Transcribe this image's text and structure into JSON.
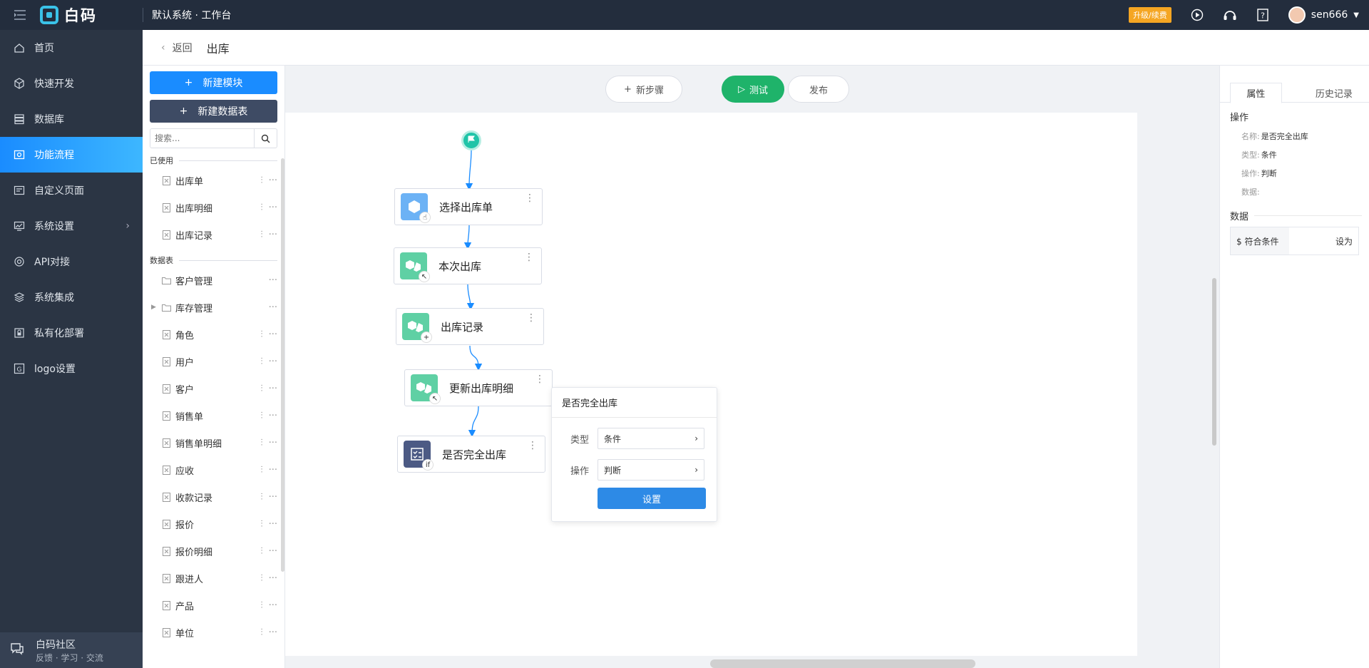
{
  "topbar": {
    "logo_text": "白码",
    "system_title": "默认系统 · 工作台",
    "upgrade_label": "升级/续费",
    "username": "sen666"
  },
  "sidebar": {
    "items": [
      {
        "label": "首页",
        "icon": "home-icon"
      },
      {
        "label": "快速开发",
        "icon": "cube-icon"
      },
      {
        "label": "数据库",
        "icon": "database-icon"
      },
      {
        "label": "功能流程",
        "icon": "flow-icon"
      },
      {
        "label": "自定义页面",
        "icon": "page-icon"
      },
      {
        "label": "系统设置",
        "icon": "settings-icon"
      },
      {
        "label": "API对接",
        "icon": "api-icon"
      },
      {
        "label": "系统集成",
        "icon": "layers-icon"
      },
      {
        "label": "私有化部署",
        "icon": "lock-icon"
      },
      {
        "label": "logo设置",
        "icon": "logo-icon"
      }
    ],
    "community": {
      "title": "白码社区",
      "subtitle": "反馈 · 学习 · 交流"
    }
  },
  "header": {
    "back_label": "返回",
    "page_title": "出库"
  },
  "left_panel": {
    "new_module": "新建模块",
    "new_table": "新建数据表",
    "search_placeholder": "搜索...",
    "used_label": "已使用",
    "used_items": [
      "出库单",
      "出库明细",
      "出库记录"
    ],
    "tables_label": "数据表",
    "folders": [
      "客户管理",
      "库存管理"
    ],
    "tables": [
      "角色",
      "用户",
      "客户",
      "销售单",
      "销售单明细",
      "应收",
      "收款记录",
      "报价",
      "报价明细",
      "跟进人",
      "产品",
      "单位"
    ]
  },
  "toolbar": {
    "new_step": "新步骤",
    "test": "测试",
    "publish": "发布"
  },
  "flow": {
    "nodes": [
      {
        "label": "选择出库单",
        "icon": "select-cube-icon",
        "color": "#6cb2f5"
      },
      {
        "label": "本次出库",
        "icon": "cubes-icon",
        "color": "#5fd0a4"
      },
      {
        "label": "出库记录",
        "icon": "cubes-add-icon",
        "color": "#5fd0a4"
      },
      {
        "label": "更新出库明细",
        "icon": "cubes-update-icon",
        "color": "#5fd0a4"
      },
      {
        "label": "是否完全出库",
        "icon": "condition-icon",
        "color": "#4c5a84"
      }
    ]
  },
  "popover": {
    "title": "是否完全出库",
    "type_label": "类型",
    "type_value": "条件",
    "op_label": "操作",
    "op_value": "判断",
    "set_button": "设置"
  },
  "right_panel": {
    "tab_props": "属性",
    "tab_history": "历史记录",
    "operation_label": "操作",
    "name_key": "名称:",
    "name_value": "是否完全出库",
    "type_key": "类型:",
    "type_value": "条件",
    "op_key": "操作:",
    "op_value": "判断",
    "data_key": "数据:",
    "data_label": "数据",
    "condition_label": "$ 符合条件",
    "set_to": "设为"
  }
}
